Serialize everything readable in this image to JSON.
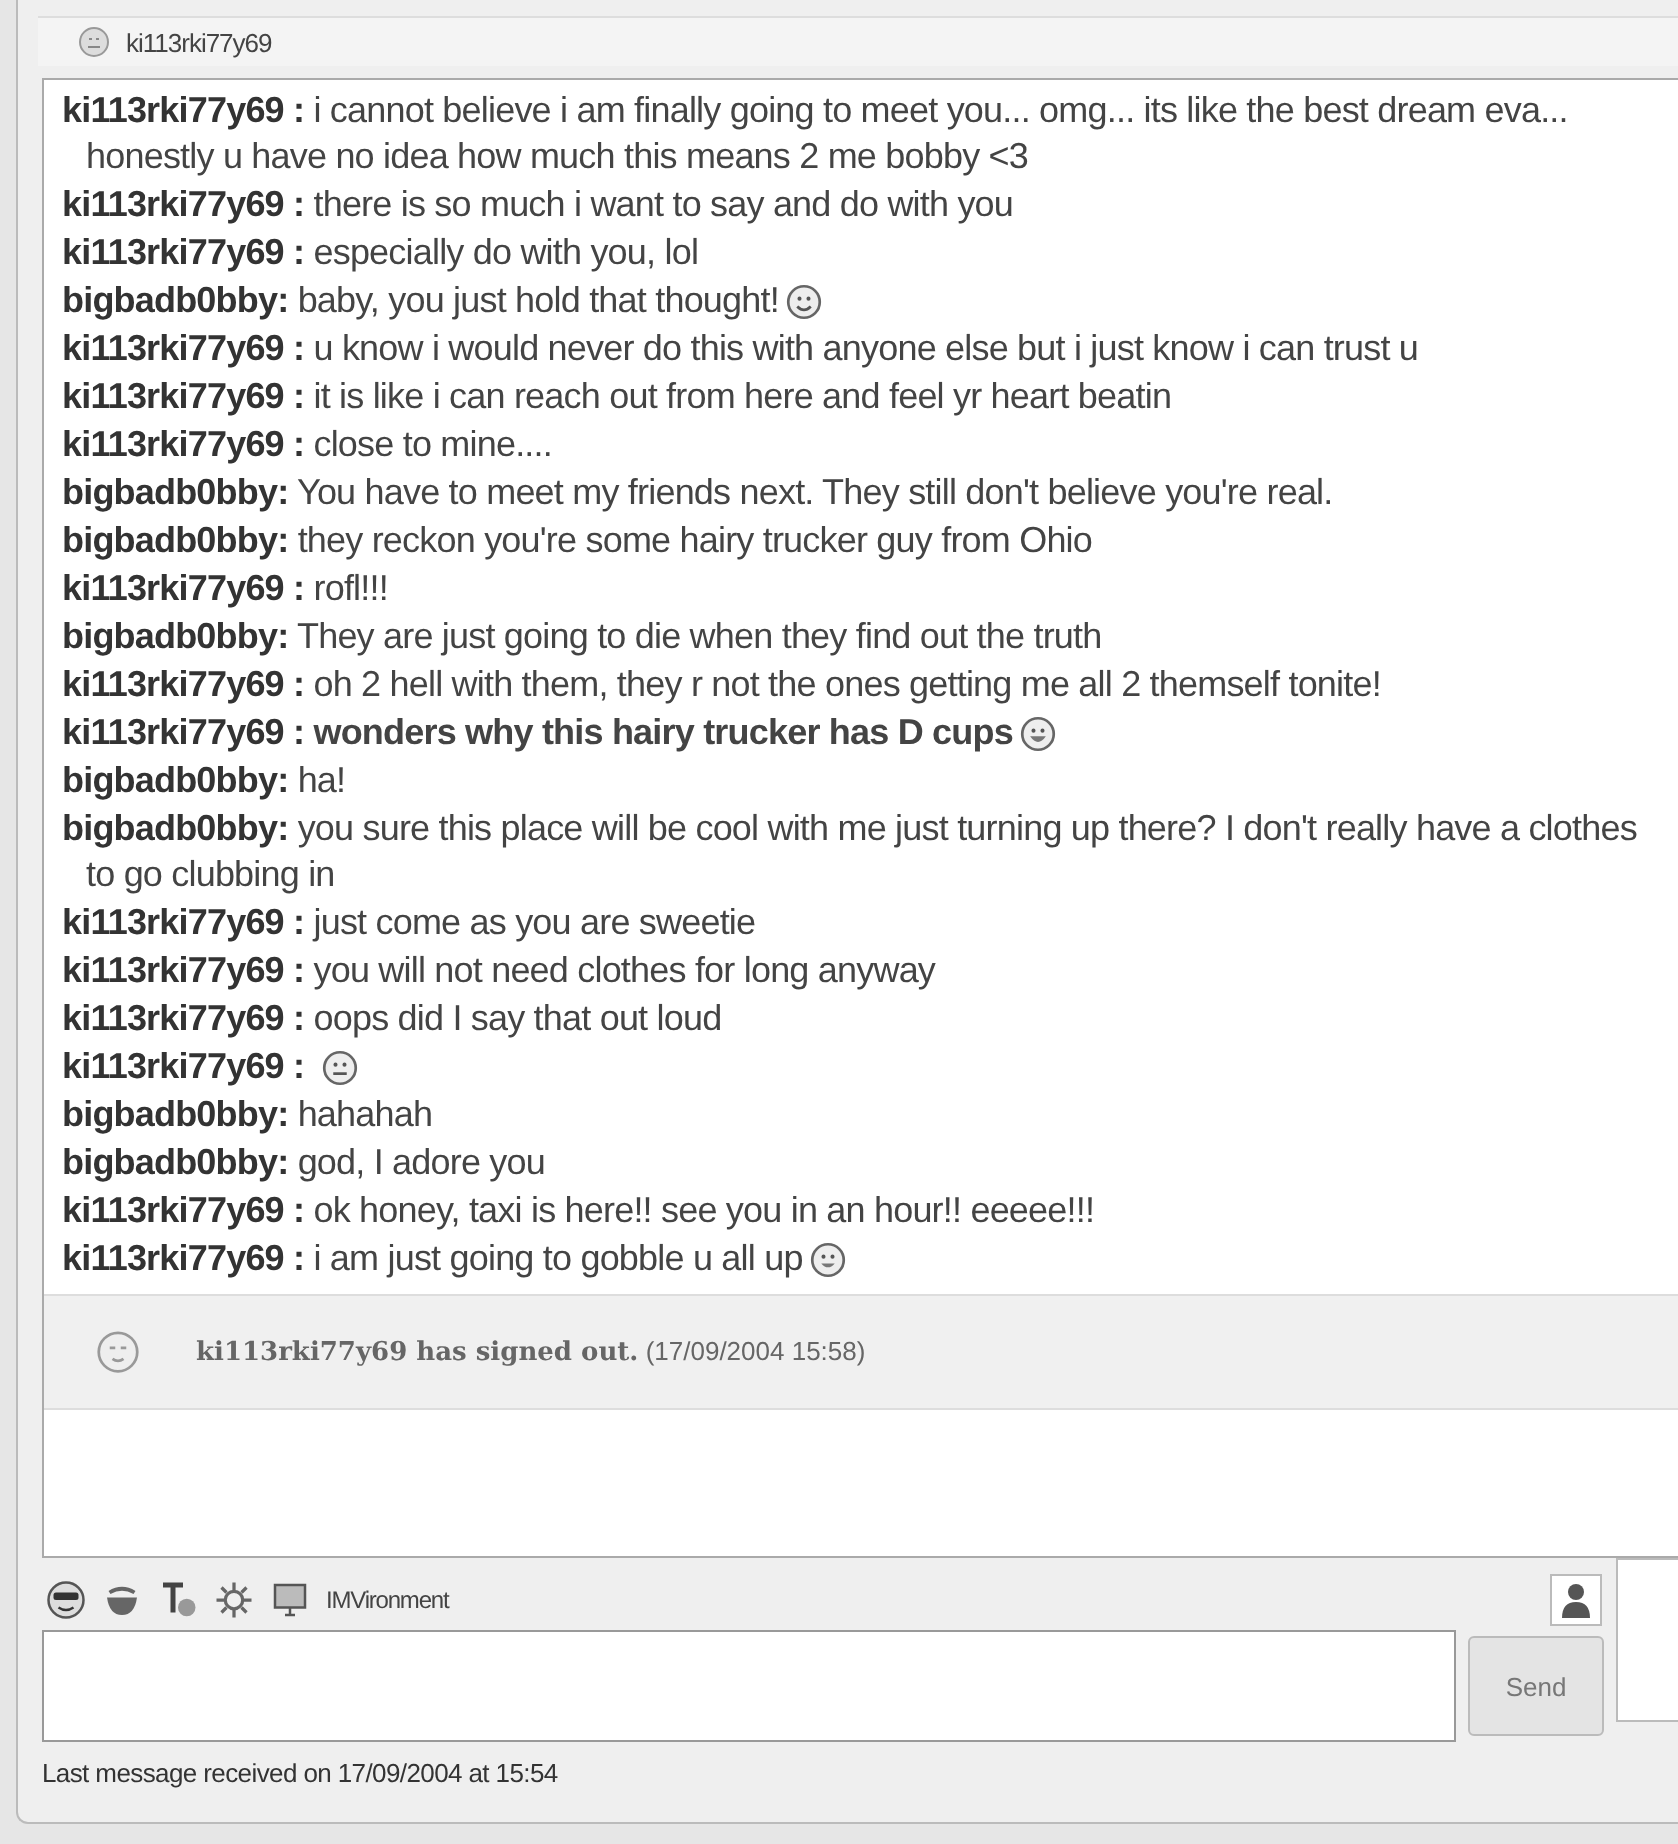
{
  "window": {
    "title": "ki113rki77y69"
  },
  "messages": [
    {
      "sender": "ki113rki77y69 :",
      "text": "i cannot believe i am finally going to meet you... omg... its like the best dream eva... honestly u have no idea how much this means 2 me bobby <3",
      "bold": false
    },
    {
      "sender": "ki113rki77y69 :",
      "text": "there is so much i want to say and do with you",
      "bold": false
    },
    {
      "sender": "ki113rki77y69 :",
      "text": "especially do with you, lol",
      "bold": false
    },
    {
      "sender": "bigbadb0bby:",
      "text": "baby, you just hold that thought!",
      "bold": false,
      "emoticon": {
        "kind": "smile"
      }
    },
    {
      "sender": "ki113rki77y69 :",
      "text": "u know i would never do this with anyone else but i just know i can trust u",
      "bold": false
    },
    {
      "sender": "ki113rki77y69 :",
      "text": "it is like i can reach out from here and feel yr heart beatin",
      "bold": false
    },
    {
      "sender": "ki113rki77y69 :",
      "text": "close to mine....",
      "bold": false
    },
    {
      "sender": "bigbadb0bby:",
      "text": "You have to meet my friends next.  They still don't believe you're real.",
      "bold": false
    },
    {
      "sender": "bigbadb0bby:",
      "text": "they reckon you're some hairy trucker guy from Ohio",
      "bold": false
    },
    {
      "sender": "ki113rki77y69 :",
      "text": "rofl!!!",
      "bold": false
    },
    {
      "sender": "bigbadb0bby:",
      "text": "They are just going to die when they find out the truth",
      "bold": false
    },
    {
      "sender": "ki113rki77y69 :",
      "text": "oh 2 hell with them, they r not the ones getting me all 2 themself tonite!",
      "bold": false
    },
    {
      "sender": "ki113rki77y69 :",
      "text": "wonders why this hairy trucker has D cups",
      "bold": true,
      "emoticon": {
        "kind": "laugh"
      }
    },
    {
      "sender": "bigbadb0bby:",
      "text": "ha!",
      "bold": false
    },
    {
      "sender": "bigbadb0bby:",
      "text": "you sure this place will be cool with me just turning up there? I don't really have a clothes to go clubbing in",
      "bold": false
    },
    {
      "sender": "ki113rki77y69 :",
      "text": "just come as you are sweetie",
      "bold": false
    },
    {
      "sender": "ki113rki77y69 :",
      "text": "you will not need clothes for long anyway",
      "bold": false
    },
    {
      "sender": "ki113rki77y69 :",
      "text": "oops did I say that out loud",
      "bold": false
    },
    {
      "sender": "ki113rki77y69 :",
      "emoticon": {
        "kind": "smirk"
      }
    },
    {
      "sender": "bigbadb0bby:",
      "text": "hahahah",
      "bold": false
    },
    {
      "sender": "bigbadb0bby:",
      "text": "god, I adore you",
      "bold": false
    },
    {
      "sender": "ki113rki77y69 :",
      "text": "ok honey, taxi is here!! see you in an hour!! eeeee!!!",
      "bold": false
    },
    {
      "sender": "ki113rki77y69 :",
      "text": "i am just going to gobble u all up",
      "bold": false,
      "emoticon": {
        "kind": "grin"
      }
    }
  ],
  "notice": {
    "text": "ki113rki77y69 has signed out.",
    "time": "(17/09/2004 15:58)"
  },
  "toolbar": {
    "label": "IMVironment"
  },
  "send_button": "Send",
  "status_bar": "Last message received on 17/09/2004 at 15:54"
}
